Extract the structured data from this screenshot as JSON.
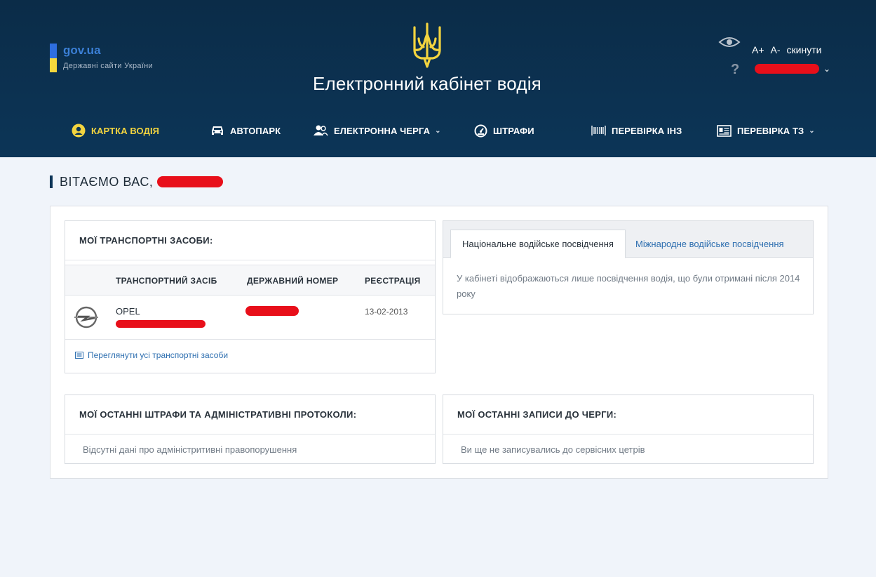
{
  "header": {
    "gov_title": "gov.ua",
    "gov_subtitle": "Державні сайти України",
    "site_title": "Електронний кабінет водія",
    "font_increase": "A+",
    "font_decrease": "A-",
    "font_reset": "скинути",
    "help": "?"
  },
  "nav": {
    "items": [
      {
        "label": "КАРТКА ВОДІЯ",
        "icon": "user-circle-icon",
        "active": true
      },
      {
        "label": "АВТОПАРК",
        "icon": "car-icon"
      },
      {
        "label": "ЕЛЕКТРОННА ЧЕРГА",
        "icon": "people-icon",
        "dropdown": true
      },
      {
        "label": "ШТРАФИ",
        "icon": "speedometer-icon"
      },
      {
        "label": "ПЕРЕВІРКА ІНЗ",
        "icon": "barcode-icon"
      },
      {
        "label": "ПЕРЕВІРКА ТЗ",
        "icon": "document-icon",
        "dropdown": true
      }
    ]
  },
  "welcome": "ВІТАЄМО ВАС,",
  "vehicles": {
    "title": "МОЇ ТРАНСПОРТНІ ЗАСОБИ:",
    "columns": [
      "ТРАНСПОРТНИЙ ЗАСІБ",
      "ДЕРЖАВНИЙ НОМЕР",
      "РЕЄСТРАЦІЯ"
    ],
    "rows": [
      {
        "brand": "OPEL",
        "registration": "13-02-2013"
      }
    ],
    "view_all": "Переглянути усі транспортні засоби"
  },
  "licenses": {
    "tabs": [
      "Національне водійське посвідчення",
      "Міжнародне водійське посвідчення"
    ],
    "active_tab": 0,
    "text": "У кабінеті відображаються лише посвідчення водія, що були отримані після 2014 року"
  },
  "fines": {
    "title": "МОЇ ОСТАННІ ШТРАФИ ТА АДМІНІСТРАТИВНІ ПРОТОКОЛИ:",
    "empty": "Відсутні дані про адміністритивні правопорушення"
  },
  "queue": {
    "title": "МОЇ ОСТАННІ ЗАПИСИ ДО ЧЕРГИ:",
    "empty": "Ви ще не записувались до сервісних цетрів"
  },
  "colors": {
    "header_bg": "#0c3557",
    "accent_yellow": "#f3d43f",
    "link_blue": "#2e6fb0",
    "redaction": "#e80f1a"
  }
}
